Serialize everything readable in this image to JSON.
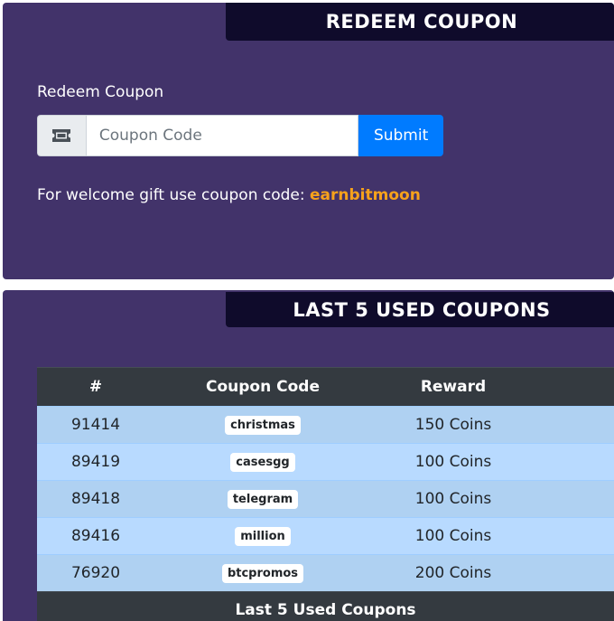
{
  "redeem_card": {
    "title": "REDEEM COUPON",
    "label": "Redeem Coupon",
    "input_placeholder": "Coupon Code",
    "submit_label": "Submit",
    "welcome_text": "For welcome gift use coupon code:",
    "welcome_code": "earnbitmoon",
    "icon": "ticket-icon"
  },
  "coupons_card": {
    "title": "LAST 5 USED COUPONS",
    "columns": [
      "#",
      "Coupon Code",
      "Reward"
    ],
    "rows": [
      {
        "id": "91414",
        "code": "christmas",
        "reward": "150 Coins"
      },
      {
        "id": "89419",
        "code": "casesgg",
        "reward": "100 Coins"
      },
      {
        "id": "89418",
        "code": "telegram",
        "reward": "100 Coins"
      },
      {
        "id": "89416",
        "code": "million",
        "reward": "100 Coins"
      },
      {
        "id": "76920",
        "code": "btcpromos",
        "reward": "200 Coins"
      }
    ],
    "footer": "Last 5 Used Coupons"
  },
  "colors": {
    "card_bg": "#42336a",
    "header_bg": "#0f0b2b",
    "accent": "#007bff",
    "highlight": "#f7a21b",
    "table_dark": "#343a40",
    "row_bg": "#b8daff"
  }
}
